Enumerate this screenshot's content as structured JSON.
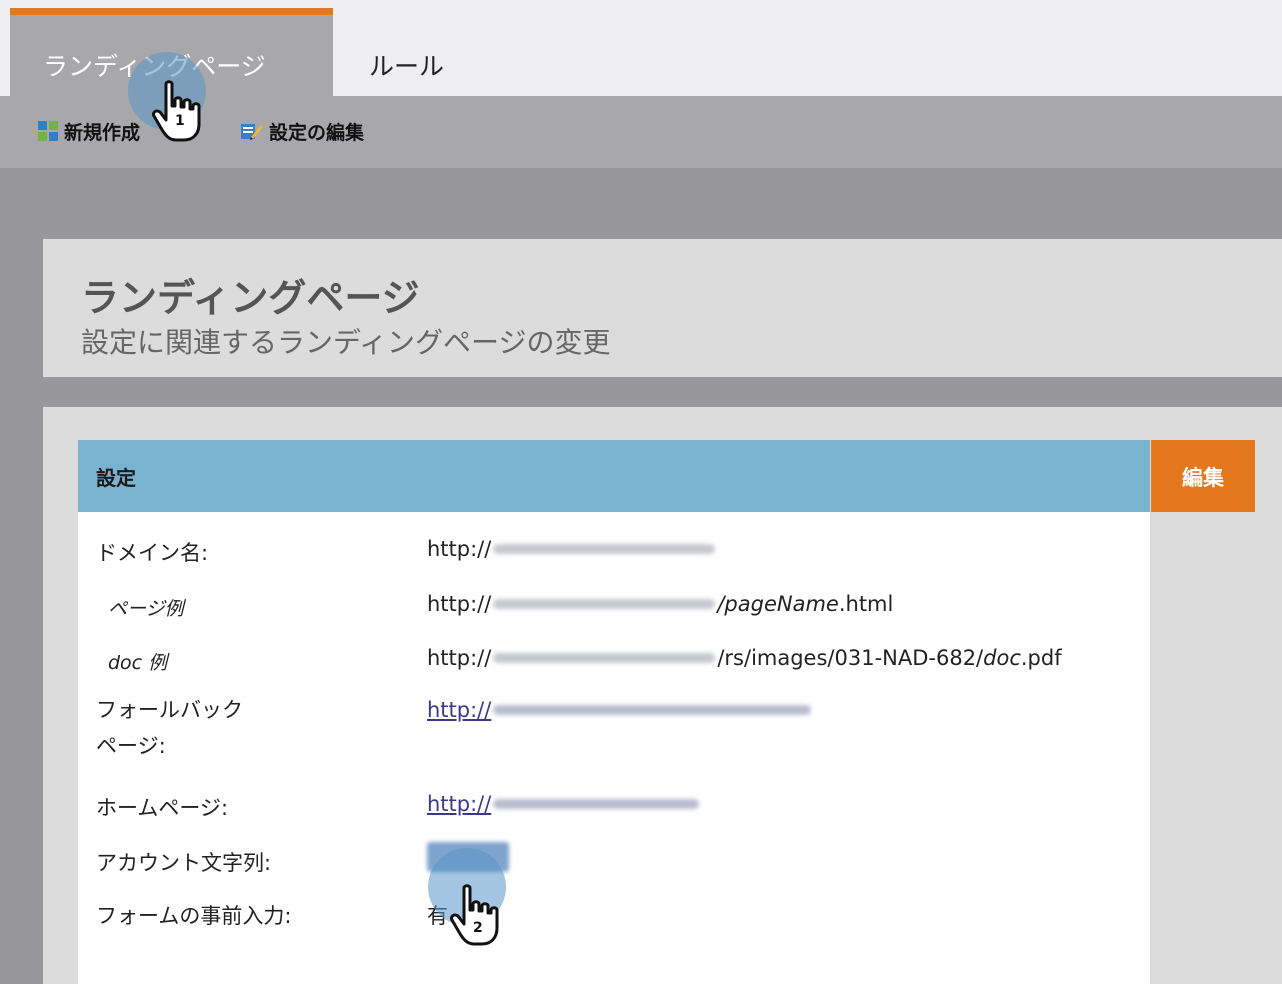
{
  "tabs": [
    {
      "label": "ランディングページ",
      "active": true
    },
    {
      "label": "ルール",
      "active": false
    }
  ],
  "toolbar": {
    "new_label": "新規作成",
    "edit_settings_label": "設定の編集"
  },
  "panel": {
    "title": "ランディングページ",
    "subtitle": "設定に関連するランディングページの変更"
  },
  "section": {
    "title": "設定",
    "edit_label": "編集",
    "rows": [
      {
        "label": "ドメイン名:",
        "value_prefix": "http://"
      },
      {
        "label": "ページ例",
        "value_prefix": "http://",
        "value_suffix_italic": "/pageName",
        "value_suffix": ".html"
      },
      {
        "label": "doc 例",
        "value_prefix": "http://",
        "value_suffix": "/rs/images/031-NAD-682/",
        "value_suffix_italic": "doc",
        "value_suffix2": ".pdf"
      },
      {
        "label_line1": "フォールバック",
        "label_line2": "ページ:",
        "value_prefix": "http://"
      },
      {
        "label": "ホームページ:",
        "value_prefix": "http://"
      },
      {
        "label": "アカウント文字列:"
      },
      {
        "label": "フォームの事前入力:",
        "value": "有"
      }
    ]
  },
  "cursors": [
    {
      "number": "1"
    },
    {
      "number": "2"
    }
  ],
  "colors": {
    "accent_orange": "#e4781c",
    "section_header_blue": "#7ab3cf",
    "toolbar_grey": "#a8a8aa",
    "main_grey": "#98989c"
  }
}
